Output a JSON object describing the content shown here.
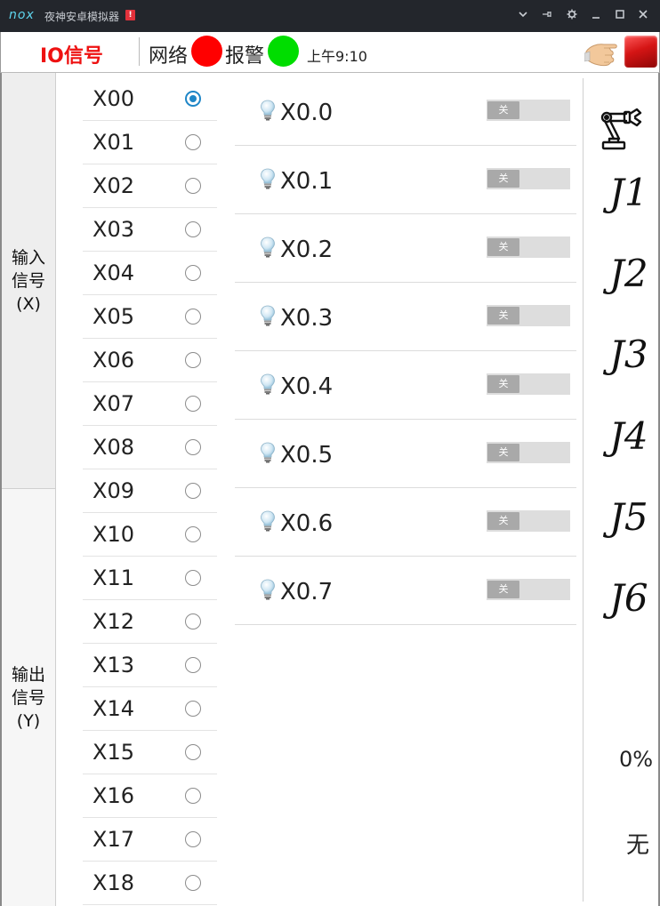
{
  "window": {
    "logo": "nox",
    "title": "夜神安卓模拟器",
    "alert_badge": "!",
    "controls": [
      "chevron-down-icon",
      "pin-icon",
      "gear-icon",
      "minimize-icon",
      "maximize-icon",
      "close-icon"
    ]
  },
  "header": {
    "title": "IO信号",
    "network_label": "网络",
    "network_status_color": "#ff0000",
    "alarm_label": "报警",
    "alarm_status_color": "#00dd00",
    "time": "上午9:10"
  },
  "tabs": [
    {
      "label": "输入信号(X)"
    },
    {
      "label": "输出信号(Y)"
    }
  ],
  "x_list": [
    {
      "label": "X00",
      "selected": true
    },
    {
      "label": "X01",
      "selected": false
    },
    {
      "label": "X02",
      "selected": false
    },
    {
      "label": "X03",
      "selected": false
    },
    {
      "label": "X04",
      "selected": false
    },
    {
      "label": "X05",
      "selected": false
    },
    {
      "label": "X06",
      "selected": false
    },
    {
      "label": "X07",
      "selected": false
    },
    {
      "label": "X08",
      "selected": false
    },
    {
      "label": "X09",
      "selected": false
    },
    {
      "label": "X10",
      "selected": false
    },
    {
      "label": "X11",
      "selected": false
    },
    {
      "label": "X12",
      "selected": false
    },
    {
      "label": "X13",
      "selected": false
    },
    {
      "label": "X14",
      "selected": false
    },
    {
      "label": "X15",
      "selected": false
    },
    {
      "label": "X16",
      "selected": false
    },
    {
      "label": "X17",
      "selected": false
    },
    {
      "label": "X18",
      "selected": false
    }
  ],
  "signals": [
    {
      "label": "X0.0",
      "state": "关"
    },
    {
      "label": "X0.1",
      "state": "关"
    },
    {
      "label": "X0.2",
      "state": "关"
    },
    {
      "label": "X0.3",
      "state": "关"
    },
    {
      "label": "X0.4",
      "state": "关"
    },
    {
      "label": "X0.5",
      "state": "关"
    },
    {
      "label": "X0.6",
      "state": "关"
    },
    {
      "label": "X0.7",
      "state": "关"
    }
  ],
  "joints": [
    "J1",
    "J2",
    "J3",
    "J4",
    "J5",
    "J6"
  ],
  "speed": "0%",
  "mode": "无"
}
